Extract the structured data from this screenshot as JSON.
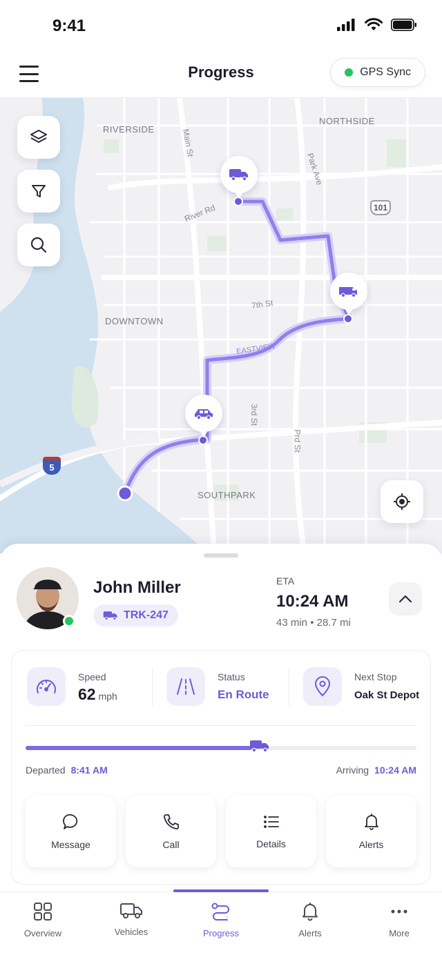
{
  "status_bar": {
    "time": "9:41"
  },
  "header": {
    "title": "Progress",
    "gps_label": "GPS Sync"
  },
  "map": {
    "areas": [
      "RIVERSIDE",
      "NORTHSIDE",
      "DOWNTOWN",
      "SOUTHPARK"
    ],
    "streets": [
      "Main St",
      "Park Ave",
      "River Rd",
      "7th St",
      "EASTVIEW",
      "3rd St",
      "Prd St"
    ],
    "highway_101": "101",
    "interstate_5": "5",
    "route_color": "#7c6ae6"
  },
  "driver": {
    "name": "John Miller",
    "vehicle_id": "TRK-247",
    "online": true
  },
  "eta": {
    "label": "ETA",
    "time": "10:24 AM",
    "summary": "43 min • 28.7 mi"
  },
  "stats": {
    "speed_label": "Speed",
    "speed_value": "62",
    "speed_unit": "mph",
    "status_label": "Status",
    "status_value": "En Route",
    "next_stop_label": "Next Stop",
    "next_stop_value": "Oak St Depot"
  },
  "trip": {
    "progress": 0.58,
    "departed_label": "Departed",
    "departed_time": "8:41 AM",
    "arriving_label": "Arriving",
    "arriving_time": "10:24 AM"
  },
  "actions": [
    {
      "label": "Message",
      "icon": "message-icon"
    },
    {
      "label": "Call",
      "icon": "phone-icon"
    },
    {
      "label": "Details",
      "icon": "list-icon"
    },
    {
      "label": "Alerts",
      "icon": "bell-icon"
    }
  ],
  "tabs": [
    {
      "label": "Overview",
      "icon": "grid-icon"
    },
    {
      "label": "Vehicles",
      "icon": "truck-icon"
    },
    {
      "label": "Progress",
      "icon": "route-icon",
      "active": true
    },
    {
      "label": "Alerts",
      "icon": "bell-icon"
    },
    {
      "label": "More",
      "icon": "more-icon"
    }
  ],
  "colors": {
    "accent": "#6d5bd8",
    "online": "#22c55e"
  }
}
